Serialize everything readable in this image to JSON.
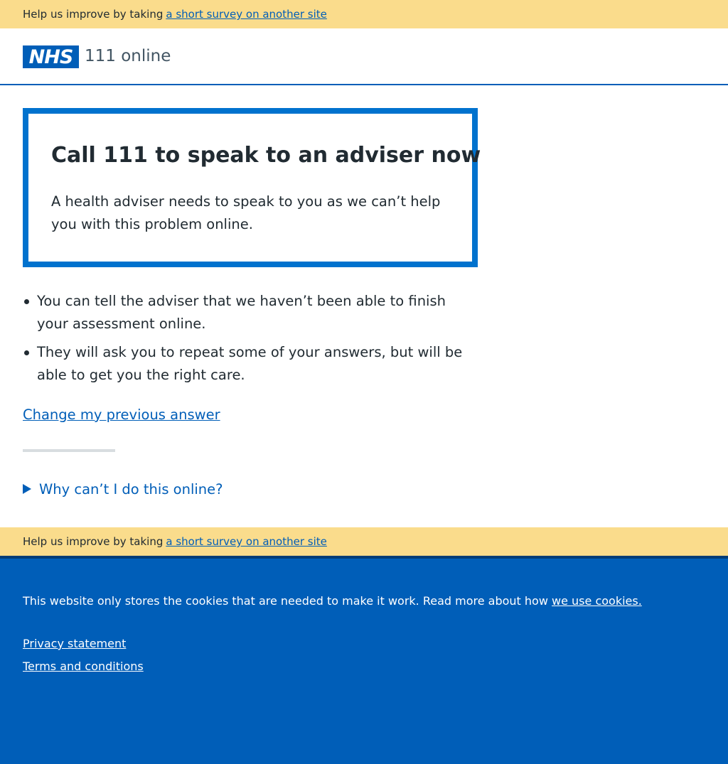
{
  "survey_banner": {
    "text": "Help us improve by taking",
    "link": "a short survey on another site"
  },
  "header": {
    "logo": "NHS",
    "service_name": "111 online"
  },
  "care_card": {
    "heading": "Call 111 to speak to an adviser now",
    "body": "A health adviser needs to speak to you as we can’t help you with this problem online."
  },
  "bullets": [
    "You can tell the adviser that we haven’t been able to finish your assessment online.",
    "They will ask you to repeat some of your answers, but will be able to get you the right care."
  ],
  "change_link": "Change my previous answer",
  "details_summary": "Why can’t I do this online?",
  "footer": {
    "cookie_text": "This website only stores the cookies that are needed to make it work. Read more about how",
    "cookie_link": "we use cookies.",
    "links": [
      "Privacy statement",
      "Terms and conditions"
    ]
  },
  "colors": {
    "nhs_blue": "#005eb8",
    "care_card_border": "#0072ce",
    "banner_yellow": "#fadc8c",
    "text": "#212b32"
  }
}
